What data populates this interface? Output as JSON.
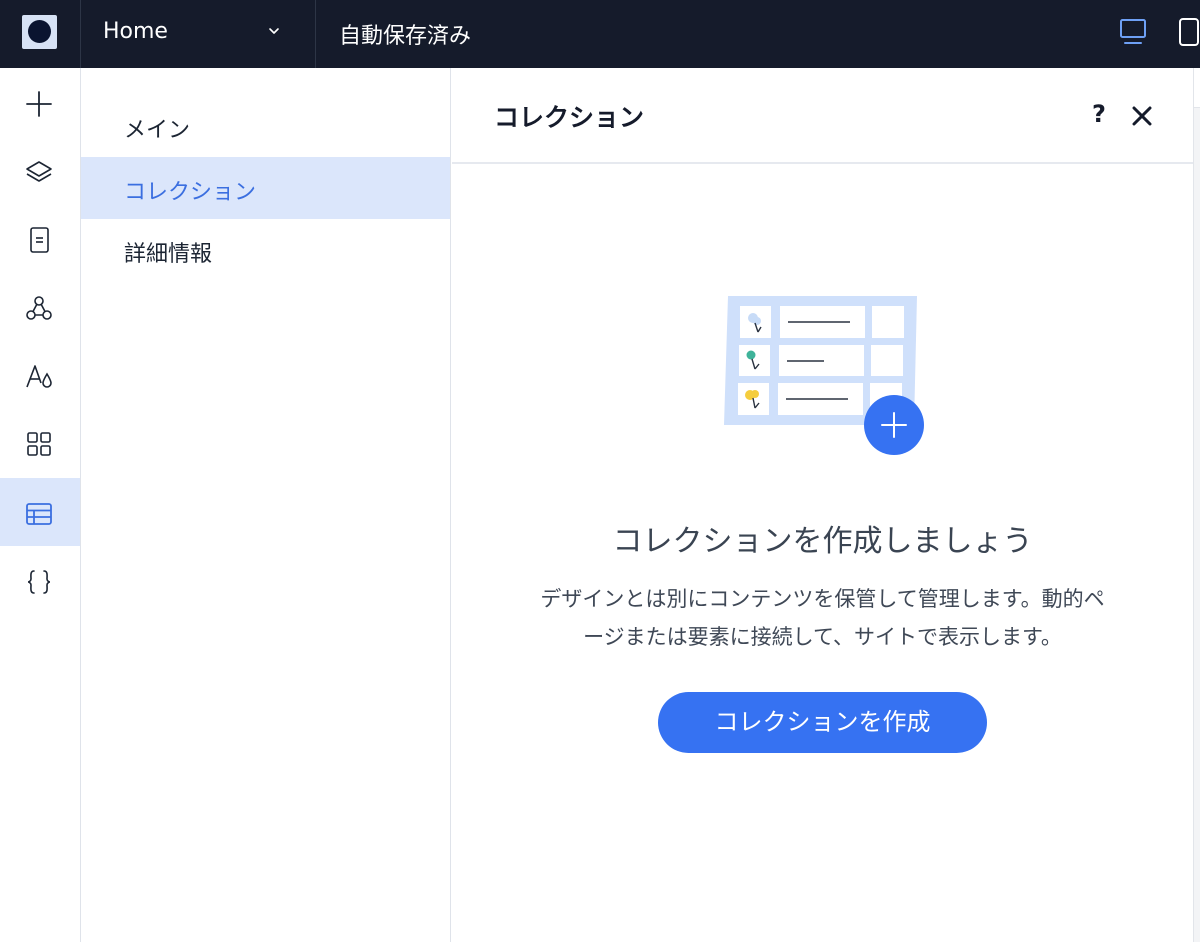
{
  "topbar": {
    "page_name": "Home",
    "autosave_status": "自動保存済み",
    "icons": [
      "logo-icon",
      "chevron-down-icon",
      "desktop-icon",
      "mobile-icon"
    ]
  },
  "rail": {
    "items": [
      {
        "icon": "plus-icon",
        "active": false
      },
      {
        "icon": "layers-icon",
        "active": false
      },
      {
        "icon": "page-icon",
        "active": false
      },
      {
        "icon": "apps-network-icon",
        "active": false
      },
      {
        "icon": "theme-font-icon",
        "active": false
      },
      {
        "icon": "grid-apps-icon",
        "active": false
      },
      {
        "icon": "table-cms-icon",
        "active": true
      },
      {
        "icon": "code-braces-icon",
        "active": false
      }
    ]
  },
  "subpanel": {
    "items": [
      {
        "label": "メイン",
        "active": false
      },
      {
        "label": "コレクション",
        "active": true
      },
      {
        "label": "詳細情報",
        "active": false
      }
    ]
  },
  "main": {
    "title": "コレクション",
    "help_label": "?",
    "empty_title": "コレクションを作成しましょう",
    "empty_desc_line1": "デザインとは別にコンテンツを保管して管理します。動的ペ",
    "empty_desc_line2": "ージまたは要素に接続して、サイトで表示します。",
    "create_button": "コレクションを作成"
  },
  "colors": {
    "topbar_bg": "#151b2b",
    "accent": "#3672f2",
    "active_bg": "#dbe6fb",
    "active_text": "#3b6fe0"
  }
}
